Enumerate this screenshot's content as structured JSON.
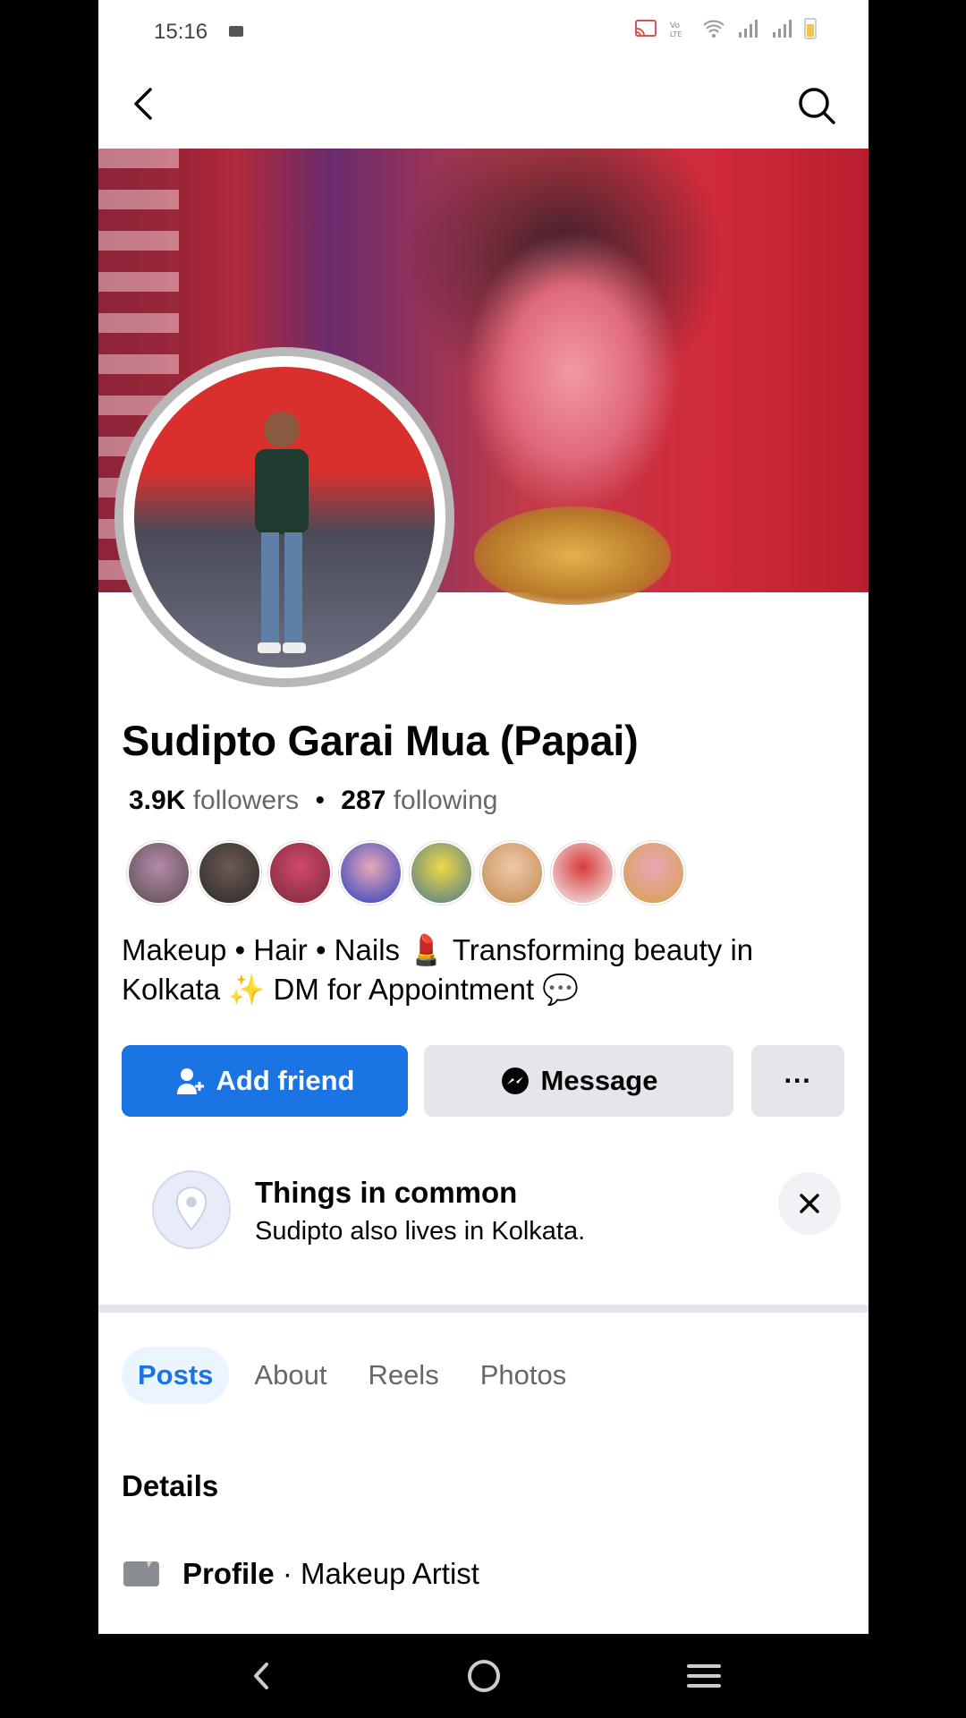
{
  "status_bar": {
    "time": "15:16",
    "icons": [
      "cast-icon",
      "volte-icon",
      "wifi-icon",
      "signal-icon",
      "signal-icon",
      "battery-icon"
    ]
  },
  "topbar": {
    "back_icon": "back-arrow-icon",
    "search_icon": "search-icon"
  },
  "profile": {
    "name": "Sudipto Garai Mua (Papai)",
    "followers_count": "3.9K",
    "followers_label": "followers",
    "separator": "•",
    "following_count": "287",
    "following_label": "following",
    "mutual_friend_avatars": 8,
    "bio": "Makeup • Hair • Nails 💄 Transforming beauty in Kolkata ✨ DM for Appointment 💬"
  },
  "actions": {
    "add_friend": "Add friend",
    "message": "Message",
    "more": "···"
  },
  "things_in_common": {
    "title": "Things in common",
    "subtitle": "Sudipto also lives in Kolkata.",
    "close_icon": "close-icon"
  },
  "tabs": [
    {
      "label": "Posts",
      "active": true
    },
    {
      "label": "About",
      "active": false
    },
    {
      "label": "Reels",
      "active": false
    },
    {
      "label": "Photos",
      "active": false
    }
  ],
  "details": {
    "title": "Details",
    "profile_label": "Profile",
    "profile_separator": " · ",
    "profile_value": "Makeup Artist"
  },
  "colors": {
    "accent": "#1b74e4",
    "button_grey": "#e4e6eb",
    "text_secondary": "#65676b"
  }
}
